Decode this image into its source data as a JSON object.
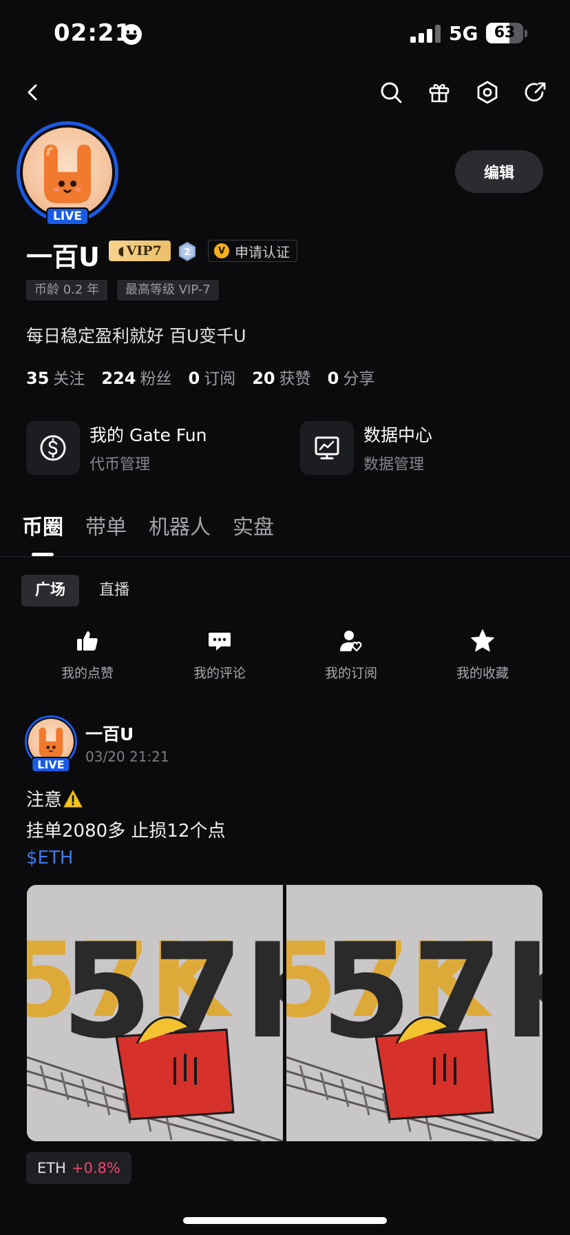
{
  "status_bar": {
    "time": "02:21",
    "network": "5G",
    "battery": "63",
    "battery_level": 0.63
  },
  "nav": {
    "icons": [
      "back-icon",
      "search-icon",
      "gift-icon",
      "settings-icon",
      "share-icon"
    ]
  },
  "profile": {
    "avatar_badge": "LIVE",
    "edit_label": "编辑",
    "name": "一百U",
    "vip": "VIP7",
    "level": "2",
    "certify_label": "申请认证",
    "tags": [
      "币龄 0.2 年",
      "最高等级 VIP-7"
    ],
    "bio": "每日稳定盈利就好 百U变千U"
  },
  "stats": [
    {
      "num": "35",
      "label": "关注"
    },
    {
      "num": "224",
      "label": "粉丝"
    },
    {
      "num": "0",
      "label": "订阅"
    },
    {
      "num": "20",
      "label": "获赞"
    },
    {
      "num": "0",
      "label": "分享"
    }
  ],
  "tools": [
    {
      "title": "我的 Gate Fun",
      "sub": "代币管理",
      "icon": "dollar-coin-icon"
    },
    {
      "title": "数据中心",
      "sub": "数据管理",
      "icon": "chart-monitor-icon"
    }
  ],
  "tabs": [
    "币圈",
    "带单",
    "机器人",
    "实盘"
  ],
  "subtabs": [
    "广场",
    "直播"
  ],
  "quick_actions": [
    {
      "label": "我的点赞",
      "icon": "thumbs-up-icon"
    },
    {
      "label": "我的评论",
      "icon": "comment-icon"
    },
    {
      "label": "我的订阅",
      "icon": "subscribe-user-icon"
    },
    {
      "label": "我的收藏",
      "icon": "star-icon"
    }
  ],
  "post": {
    "avatar_badge": "LIVE",
    "author": "一百U",
    "time": "03/20 21:21",
    "line1": "注意",
    "line2": "挂单2080多 止损12个点",
    "hashtag": "$ETH",
    "ticker_symbol": "ETH",
    "ticker_change": "+0.8%",
    "image_text": "57K"
  },
  "colors": {
    "accent_blue": "#1a5be6",
    "link_blue": "#3c7bf2",
    "rise_red": "#f0466e",
    "vip_gold": "#eabf6a"
  }
}
